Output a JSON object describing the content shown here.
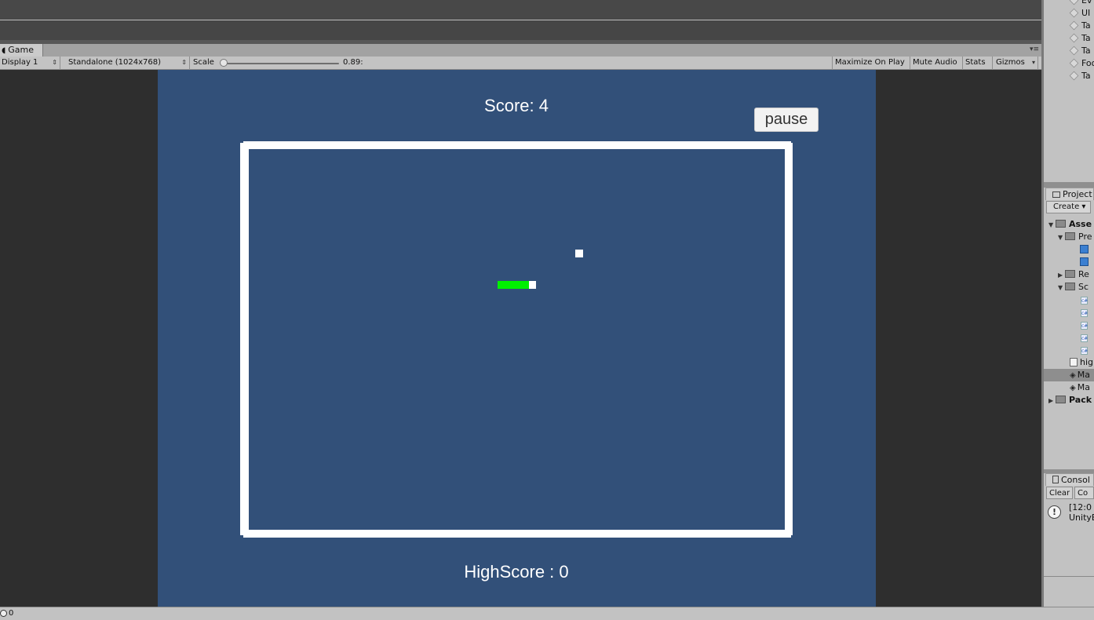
{
  "game_tab": {
    "label": "Game",
    "icon": "pacman-icon"
  },
  "toolbar": {
    "display": "Display 1",
    "resolution": "Standalone (1024x768)",
    "scale_label": "Scale",
    "scale_value": "0.89:",
    "maximize_on_play": "Maximize On Play",
    "mute_audio": "Mute Audio",
    "stats": "Stats",
    "gizmos": "Gizmos"
  },
  "game": {
    "score": "Score: 4",
    "highscore": "HighScore : 0",
    "pause_label": "pause",
    "background_color": "#325079",
    "snake_color": "#00f000",
    "wall_color": "#ffffff"
  },
  "hierarchy": {
    "items": [
      "Ev",
      "UI",
      "Ta",
      "Ta",
      "Ta",
      "Foo",
      "Ta"
    ]
  },
  "project": {
    "tab": "Project",
    "create": "Create",
    "rows": [
      {
        "label": "Asse",
        "type": "folder",
        "bold": true
      },
      {
        "label": "Pre",
        "type": "folder"
      },
      {
        "label": "",
        "type": "prefab"
      },
      {
        "label": "",
        "type": "prefab"
      },
      {
        "label": "Re",
        "type": "folder"
      },
      {
        "label": "Sc",
        "type": "folder"
      },
      {
        "label": "",
        "type": "script"
      },
      {
        "label": "",
        "type": "script"
      },
      {
        "label": "",
        "type": "script"
      },
      {
        "label": "",
        "type": "script"
      },
      {
        "label": "",
        "type": "script"
      },
      {
        "label": "hig",
        "type": "text"
      },
      {
        "label": "Ma",
        "type": "scene"
      },
      {
        "label": "Ma",
        "type": "scene"
      },
      {
        "label": "Pack",
        "type": "folder",
        "bold": true
      }
    ]
  },
  "console": {
    "tab": "Consol",
    "clear": "Clear",
    "collapse": "Co",
    "entry_line1": "[12:0",
    "entry_line2": "UnityE"
  },
  "status": {
    "text": "0"
  }
}
